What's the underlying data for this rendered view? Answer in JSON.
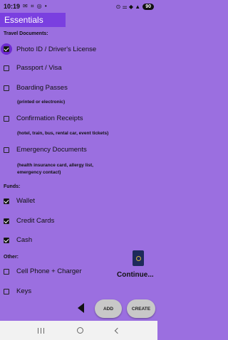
{
  "status": {
    "time": "10:19",
    "left_icons": "✉ ⌗ ◎ •",
    "right_icons": "⊙ ⚌ ◆ ▲",
    "battery": "90"
  },
  "header": {
    "title": "Essentials"
  },
  "sections": {
    "travel": "Travel Documents:",
    "funds": "Funds:",
    "other": "Other:"
  },
  "items": {
    "photo_id": "Photo ID / Driver's License",
    "passport": "Passport / Visa",
    "boarding": "Boarding Passes",
    "confirmation": "Confirmation Receipts",
    "emergency": "Emergency Documents",
    "wallet": "Wallet",
    "credit_cards": "Credit Cards",
    "cash": "Cash",
    "cell_phone": "Cell Phone + Charger",
    "keys": "Keys"
  },
  "checked": {
    "photo_id": true,
    "passport": false,
    "boarding": false,
    "confirmation": false,
    "emergency": false,
    "wallet": true,
    "credit_cards": true,
    "cash": true,
    "cell_phone": false,
    "keys": false
  },
  "notes": {
    "boarding": "(printed or electronic)",
    "confirmation": "(hotel, train, bus, rental car, event tickets)",
    "emergency_line1": "(health insurance card, allergy list,",
    "emergency_line2": "emergency contact)"
  },
  "actions": {
    "continue": "Continue...",
    "add": "ADD",
    "create": "CREATE"
  },
  "icons": {
    "passport": "passport-icon",
    "back": "back-arrow-icon"
  },
  "colors": {
    "background": "#9b6fe0",
    "header": "#7a3fe0"
  }
}
